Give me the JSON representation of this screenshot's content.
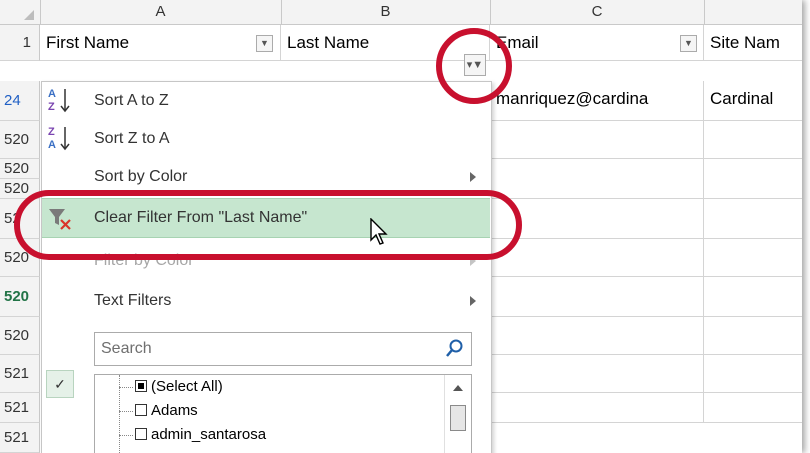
{
  "columns": [
    "A",
    "B",
    "C"
  ],
  "row_headers": [
    "1",
    "24",
    "520",
    "520",
    "520",
    "52",
    "520",
    "520",
    "520",
    "521",
    "521",
    "521"
  ],
  "header_cells": {
    "a": "First Name",
    "b": "Last Name",
    "c": "Email",
    "d": "Site Nam"
  },
  "data_row": {
    "c": "manriquez@cardina",
    "d": "Cardinal"
  },
  "menu": {
    "sort_az": "Sort A to Z",
    "sort_za": "Sort Z to A",
    "sort_color": "Sort by Color",
    "clear_filter": "Clear Filter From \"Last Name\"",
    "filter_color": "Filter by Color",
    "text_filters": "Text Filters",
    "search_placeholder": "Search",
    "list_items": [
      "(Select All)",
      "Adams",
      "admin_santarosa"
    ]
  },
  "colors": {
    "highlight_green": "#c6e6cf",
    "annotation_red": "#c8102e",
    "excel_green": "#217346"
  },
  "icons": {
    "sort_az": "sort-ascending-icon",
    "sort_za": "sort-descending-icon",
    "clear_filter": "clear-filter-icon",
    "search": "magnifier-icon",
    "filter_active": "filter-funnel-icon"
  }
}
